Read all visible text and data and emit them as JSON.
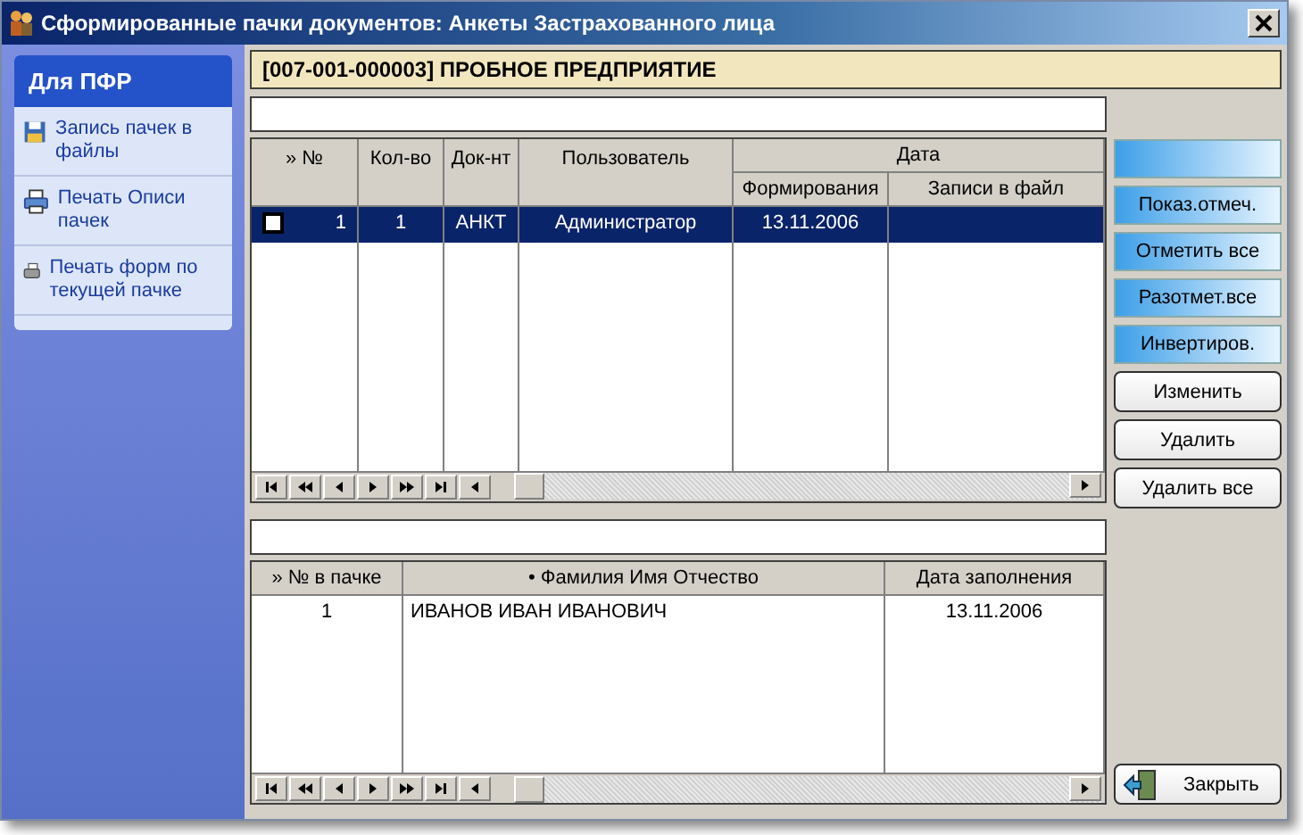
{
  "window": {
    "title": "Сформированные пачки документов: Анкеты Застрахованного лица"
  },
  "sidebar": {
    "title": "Для ПФР",
    "items": [
      {
        "label": "Запись пачек в файлы"
      },
      {
        "label": "Печать Описи пачек"
      },
      {
        "label": "Печать форм по текущей пачке"
      }
    ]
  },
  "company": "[007-001-000003] ПРОБНОЕ ПРЕДПРИЯТИЕ",
  "packs_table": {
    "group_header": "Дата",
    "columns": [
      {
        "label": "» №",
        "group": false
      },
      {
        "label": "Кол-во",
        "group": false
      },
      {
        "label": "Док-нт",
        "group": false
      },
      {
        "label": "Пользователь",
        "group": false
      },
      {
        "label": "Формирования",
        "group": true
      },
      {
        "label": "Записи в файл",
        "group": true
      }
    ],
    "rows": [
      {
        "checked": false,
        "selected": true,
        "cells": [
          "1",
          "1",
          "АНКТ",
          "Администратор",
          "13.11.2006"
        ]
      }
    ]
  },
  "side_buttons": [
    {
      "label": "Показ.отмеч.",
      "kind": "gradient"
    },
    {
      "label": "Отметить все",
      "kind": "gradient"
    },
    {
      "label": "Разотмет.все",
      "kind": "gradient"
    },
    {
      "label": "Инвертиров.",
      "kind": "gradient"
    },
    {
      "label": "Изменить",
      "kind": "plain"
    },
    {
      "label": "Удалить",
      "kind": "plain"
    },
    {
      "label": "Удалить все",
      "kind": "plain"
    }
  ],
  "members_table": {
    "columns": [
      "» № в пачке",
      "• Фамилия Имя Отчество",
      "Дата заполнения"
    ],
    "rows": [
      {
        "cells": [
          "1",
          "ИВАНОВ ИВАН ИВАНОВИЧ",
          "13.11.2006"
        ]
      }
    ]
  },
  "close_button": "Закрыть"
}
